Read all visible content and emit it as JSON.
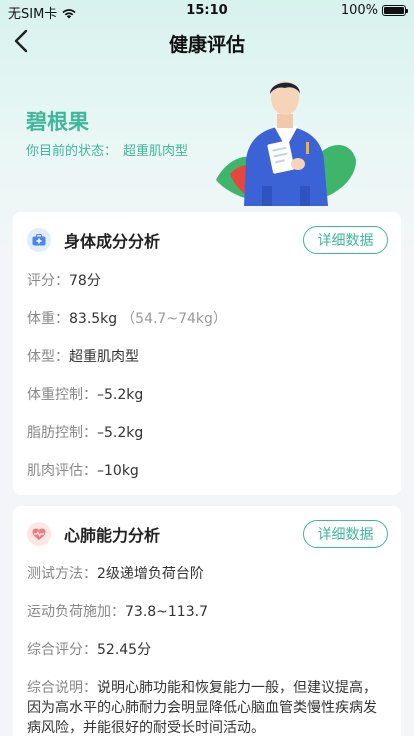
{
  "status_bar": {
    "carrier": "无SIM卡",
    "time": "15:10",
    "battery": "100%"
  },
  "nav": {
    "title": "健康评估",
    "back_icon": "chevron-left-icon"
  },
  "profile": {
    "name": "碧根果",
    "status_label": "你目前的状态：",
    "status_value": "超重肌肉型"
  },
  "colors": {
    "accent": "#3fb79a",
    "hero_bg": "#d8f2ee",
    "card_icon_body_bg": "#e3ecfb",
    "card_icon_body": "#4b86e8",
    "card_icon_heart_bg": "#fde6e6",
    "card_icon_heart": "#f07b7b"
  },
  "body_card": {
    "icon": "medical-kit-icon",
    "title": "身体成分分析",
    "detail_label": "详细数据",
    "rows": [
      {
        "label": "评分：",
        "value": "78分"
      },
      {
        "label": "体重：",
        "value": "83.5kg",
        "extra": "（54.7~74kg）"
      },
      {
        "label": "体型：",
        "value": "超重肌肉型"
      },
      {
        "label": "体重控制：",
        "value": "–5.2kg"
      },
      {
        "label": "脂肪控制：",
        "value": "–5.2kg"
      },
      {
        "label": "肌肉评估：",
        "value": "–10kg"
      }
    ]
  },
  "heart_card": {
    "icon": "heart-pulse-icon",
    "title": "心肺能力分析",
    "detail_label": "详细数据",
    "rows": [
      {
        "label": "测试方法：",
        "value": "2级递增负荷台阶"
      },
      {
        "label": "运动负荷施加：",
        "value": "73.8~113.7"
      },
      {
        "label": "综合评分：",
        "value": "52.45分"
      }
    ],
    "summary_label": "综合说明：",
    "summary_text": "说明心肺功能和恢复能力一般，但建议提高，因为高水平的心肺耐力会明显降低心脑血管类慢性疾病发病风险，并能很好的耐受长时间活动。"
  }
}
